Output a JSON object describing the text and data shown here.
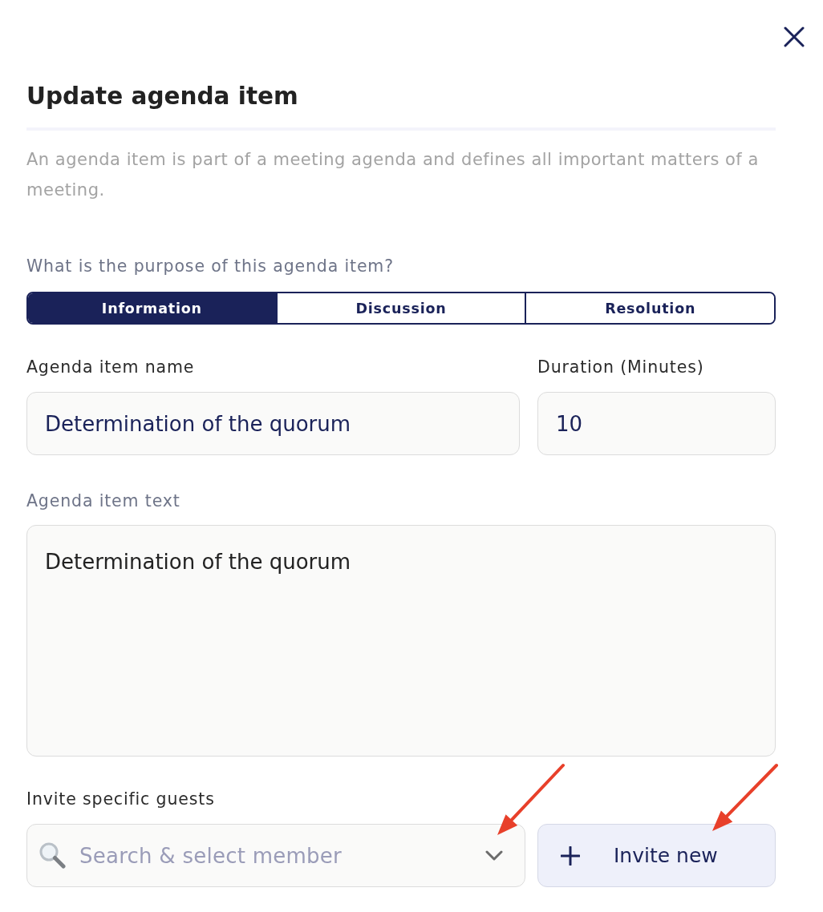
{
  "dialog": {
    "title": "Update agenda item",
    "description": "An agenda item is part of a meeting agenda and defines all important matters of a meeting."
  },
  "purpose": {
    "label": "What is the purpose of this agenda item?",
    "options": [
      {
        "label": "Information",
        "selected": true
      },
      {
        "label": "Discussion",
        "selected": false
      },
      {
        "label": "Resolution",
        "selected": false
      }
    ]
  },
  "fields": {
    "name": {
      "label": "Agenda item name",
      "value": "Determination of the quorum"
    },
    "duration": {
      "label": "Duration (Minutes)",
      "value": "10"
    },
    "text": {
      "label": "Agenda item text",
      "value": "Determination of the quorum"
    }
  },
  "guests": {
    "label": "Invite specific guests",
    "search": {
      "placeholder": "Search & select member"
    },
    "invite_button": "Invite new"
  }
}
